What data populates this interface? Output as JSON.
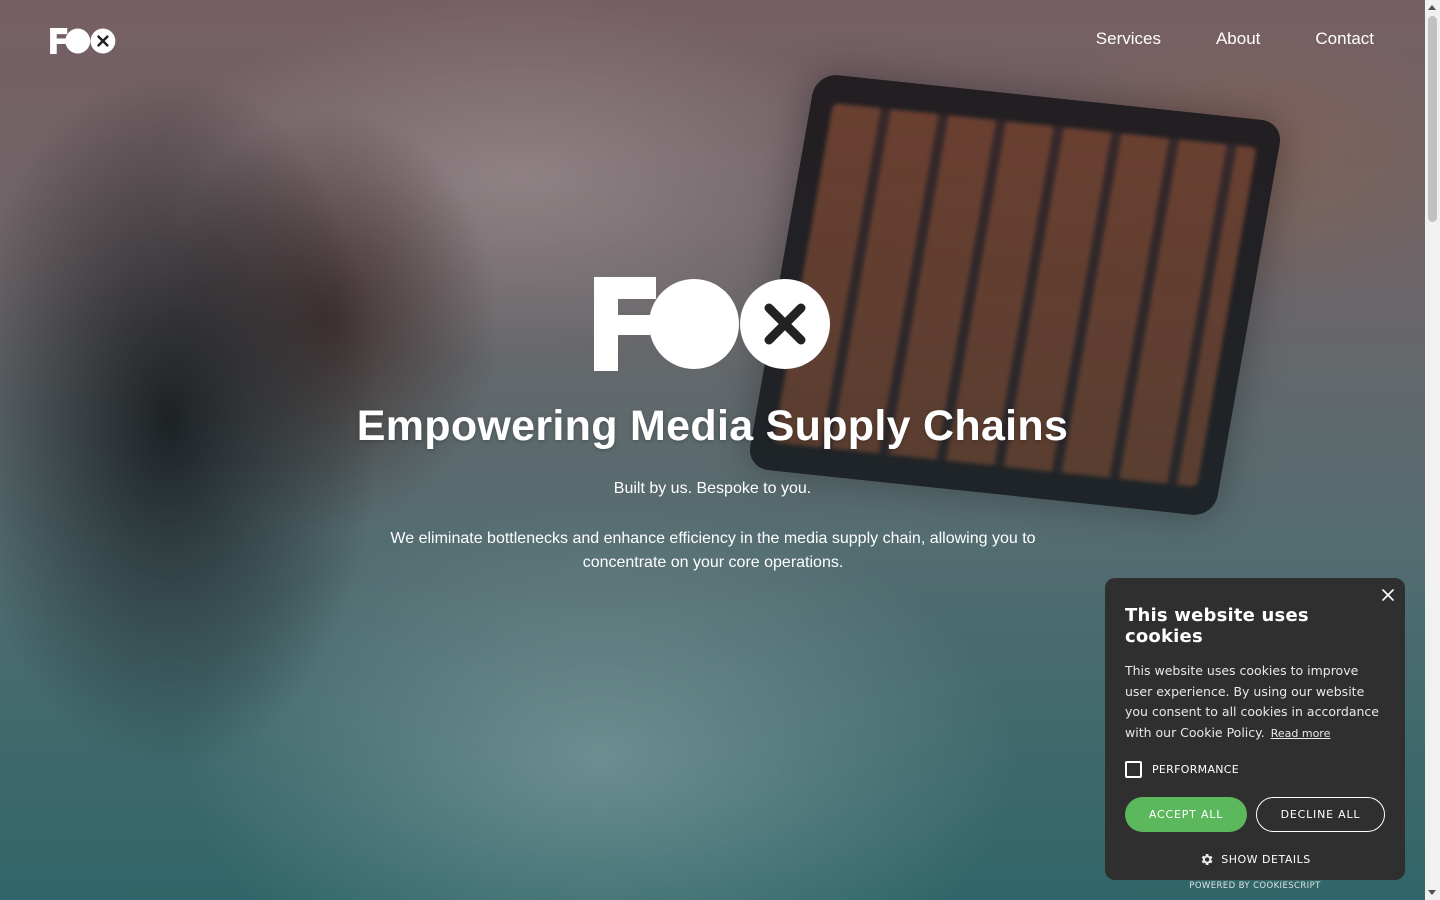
{
  "nav": {
    "items": [
      {
        "label": "Services"
      },
      {
        "label": "About"
      },
      {
        "label": "Contact"
      }
    ]
  },
  "hero": {
    "title": "Empowering Media Supply Chains",
    "subtitle": "Built by us. Bespoke to you.",
    "description": "We eliminate bottlenecks and enhance efficiency in the media supply chain, allowing you to concentrate on your core operations."
  },
  "cookie": {
    "title": "This website uses cookies",
    "text": "This website uses cookies to improve user experience. By using our website you consent to all cookies in accordance with our Cookie Policy.",
    "read_more": "Read more",
    "performance_label": "PERFORMANCE",
    "performance_checked": false,
    "accept_label": "ACCEPT ALL",
    "decline_label": "DECLINE ALL",
    "show_details_label": "SHOW DETAILS",
    "powered_by": "POWERED BY COOKIESCRIPT",
    "accept_color": "#5cb85c",
    "background_color": "#2f2f2f"
  },
  "icons": {
    "logo": "foox-logo",
    "close": "close-icon",
    "gear": "gear-icon"
  }
}
